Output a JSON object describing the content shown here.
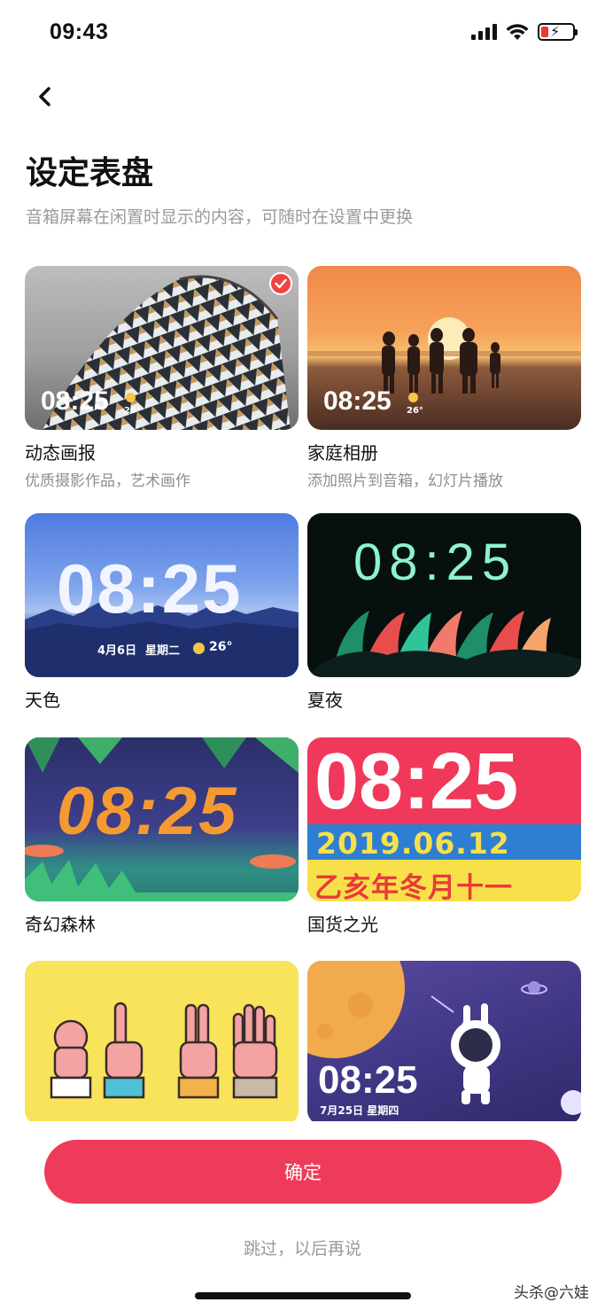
{
  "status_bar": {
    "time": "09:43"
  },
  "header": {
    "title": "设定表盘",
    "subtitle": "音箱屏幕在闲置时显示的内容，可随时在设置中更换"
  },
  "cards": [
    {
      "title": "动态画报",
      "desc": "优质摄影作品，艺术画作",
      "time": "08:25",
      "temp": "26°",
      "selected": true
    },
    {
      "title": "家庭相册",
      "desc": "添加照片到音箱，幻灯片播放",
      "time": "08:25",
      "temp": "26°"
    },
    {
      "title": "天色",
      "time": "08:25",
      "date": "4月6日",
      "weekday": "星期二",
      "temp": "26°"
    },
    {
      "title": "夏夜",
      "time": "08:25"
    },
    {
      "title": "奇幻森林",
      "time": "08:25"
    },
    {
      "title": "国货之光",
      "time": "08:25",
      "date": "2019.06.12",
      "lunar": "乙亥年冬月十一"
    },
    {
      "title": ""
    },
    {
      "title": "",
      "time": "08:25",
      "date": "7月25日 星期四"
    }
  ],
  "actions": {
    "confirm_label": "确定",
    "skip_label": "跳过，以后再说"
  },
  "watermark": "头杀@六娃"
}
